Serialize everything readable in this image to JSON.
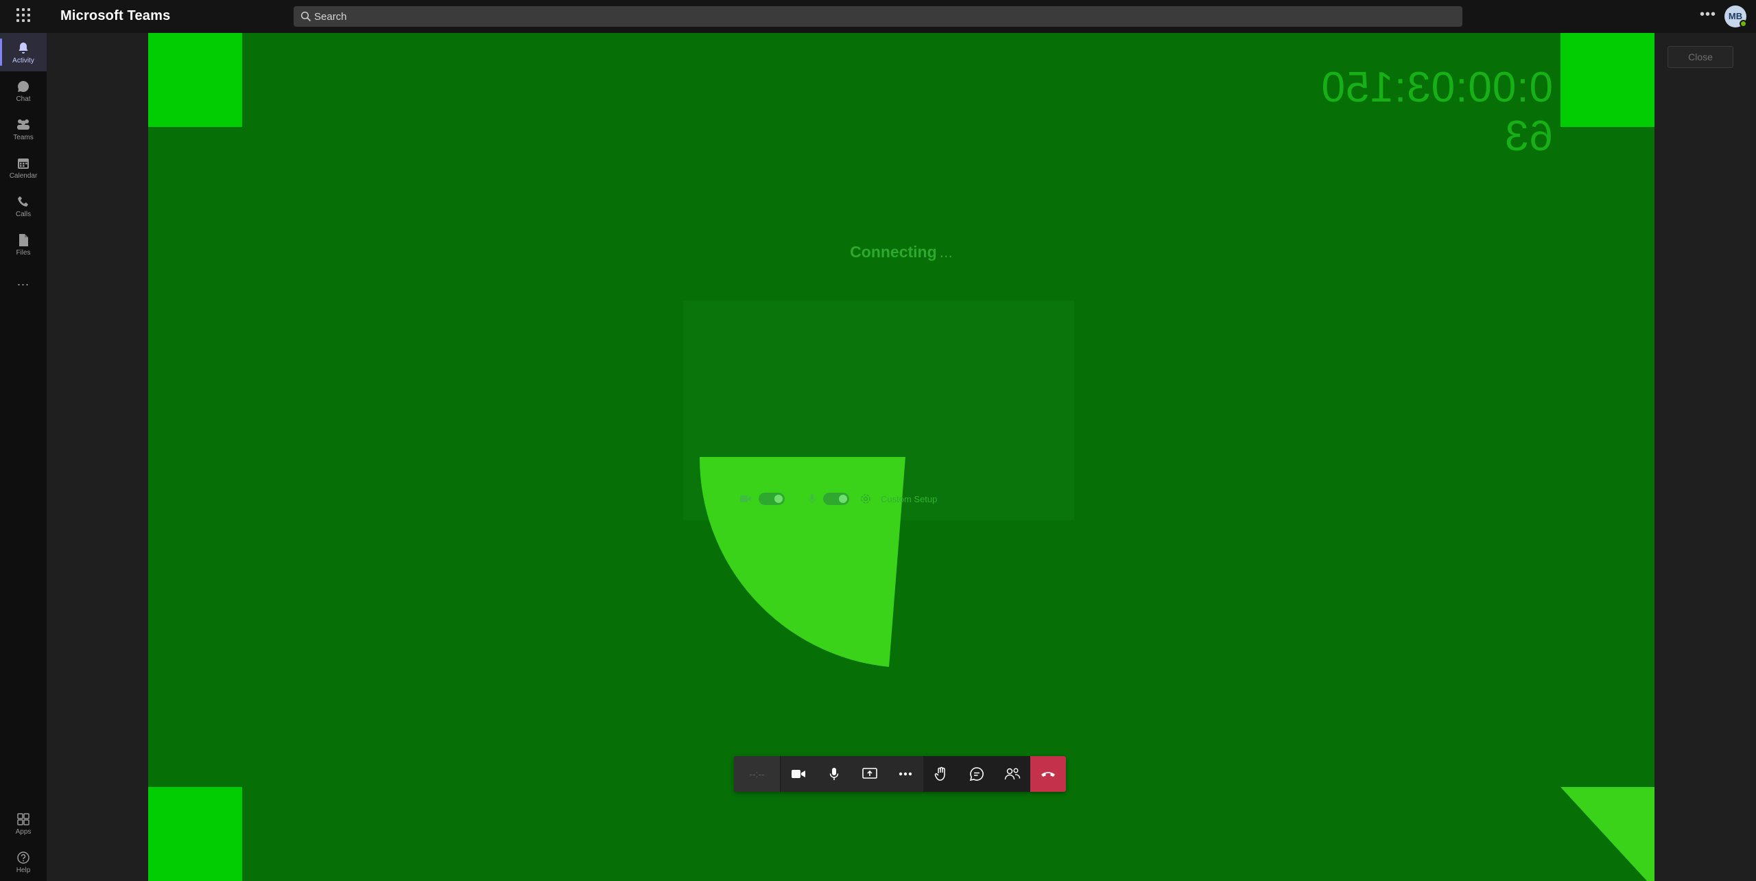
{
  "app": {
    "title": "Microsoft Teams",
    "user_initials": "MB"
  },
  "search": {
    "placeholder": "Search"
  },
  "rail": {
    "items": [
      {
        "label": "Activity",
        "icon": "bell-icon"
      },
      {
        "label": "Chat",
        "icon": "chat-icon"
      },
      {
        "label": "Teams",
        "icon": "teams-icon"
      },
      {
        "label": "Calendar",
        "icon": "calendar-icon"
      },
      {
        "label": "Calls",
        "icon": "phone-icon"
      },
      {
        "label": "Files",
        "icon": "file-icon"
      }
    ],
    "more": "...",
    "bottom": [
      {
        "label": "Apps",
        "icon": "apps-icon"
      },
      {
        "label": "Help",
        "icon": "help-icon"
      }
    ]
  },
  "meeting": {
    "close_label": "Close",
    "mirrored_timer": "0:00:03:150 63",
    "status": "Connecting",
    "status_dots": "...",
    "custom_setup": "Custom Setup",
    "call_time": "--:--"
  },
  "colors": {
    "stage": "#066f06",
    "corner": "#02cc02",
    "pie": "#3ad31a",
    "hangup": "#c4314b",
    "accent": "#7f85f5"
  }
}
